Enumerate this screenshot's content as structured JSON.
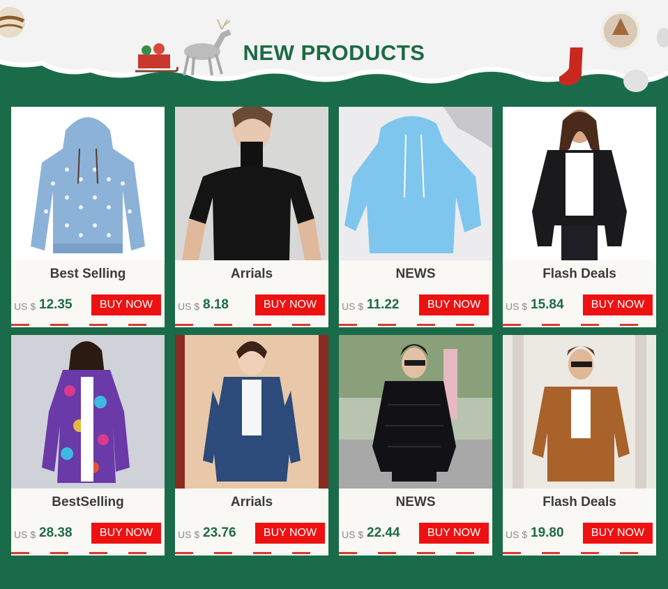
{
  "banner": {
    "title": "NEW PRODUCTS"
  },
  "currency_label": "US $",
  "buy_label": "BUY NOW",
  "products": [
    {
      "name": "Best Selling",
      "price": "12.35",
      "image": "blue-polka-dot-hoodie"
    },
    {
      "name": "Arrials",
      "price": "8.18",
      "image": "black-turtleneck-top"
    },
    {
      "name": "NEWS",
      "price": "11.22",
      "image": "light-blue-fleece-hoodie"
    },
    {
      "name": "Flash Deals",
      "price": "15.84",
      "image": "black-moto-jacket"
    },
    {
      "name": "BestSelling",
      "price": "28.38",
      "image": "floral-print-long-coat"
    },
    {
      "name": "Arrials",
      "price": "23.76",
      "image": "denim-hooded-jacket"
    },
    {
      "name": "NEWS",
      "price": "22.44",
      "image": "black-puffer-jacket"
    },
    {
      "name": "Flash Deals",
      "price": "19.80",
      "image": "brown-teddy-jacket"
    }
  ],
  "colors": {
    "background": "#1a6b4a",
    "title": "#1d6a45",
    "price": "#1d6a45",
    "buy_button": "#ee1111",
    "card": "#f9f8f4"
  }
}
